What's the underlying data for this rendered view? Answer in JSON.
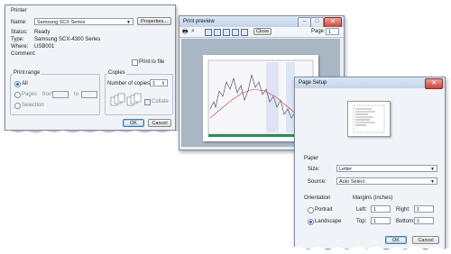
{
  "printer_dialog": {
    "title": "Printer",
    "printer_group_label": "Printer",
    "name_label": "Name:",
    "name_value": "Samsung SCX Series",
    "properties_label": "Properties...",
    "status_label": "Status:",
    "status_value": "Ready",
    "type_label": "Type:",
    "type_value": "Samsung SCX-4300 Series",
    "where_label": "Where:",
    "where_value": "USB001",
    "comment_label": "Comment:",
    "print_to_file_label": "Print to file",
    "print_range_label": "Print range",
    "all_label": "All",
    "pages_label": "Pages",
    "from_label": "from",
    "to_label": "to",
    "selection_label": "Selection",
    "copies_group_label": "Copies",
    "num_copies_label": "Number of copies:",
    "num_copies_value": "1",
    "collate_label": "Collate",
    "collate_icon_labels": [
      "1",
      "2",
      "3"
    ],
    "ok_label": "OK",
    "cancel_label": "Cancel"
  },
  "print_preview": {
    "title": "Print preview",
    "close_label": "Close",
    "page_label": "Page",
    "page_value": "1"
  },
  "page_setup": {
    "title": "Page Setup",
    "paper_group_label": "Paper",
    "size_label": "Size:",
    "size_value": "Letter",
    "source_label": "Source:",
    "source_value": "Auto Select",
    "orientation_label": "Orientation",
    "portrait_label": "Portrait",
    "landscape_label": "Landscape",
    "margins_label": "Margins (inches)",
    "left_label": "Left:",
    "left_value": "1",
    "right_label": "Right:",
    "right_value": "1",
    "top_label": "Top:",
    "top_value": "1",
    "bottom_label": "Bottom:",
    "bottom_value": "1",
    "ok_label": "OK",
    "cancel_label": "Cancel"
  },
  "colors": {
    "titlebar": "#c2d4e9",
    "window_bg": "#e9eef4",
    "close_red": "#c7453a",
    "radio_blue": "#2a67b3"
  }
}
